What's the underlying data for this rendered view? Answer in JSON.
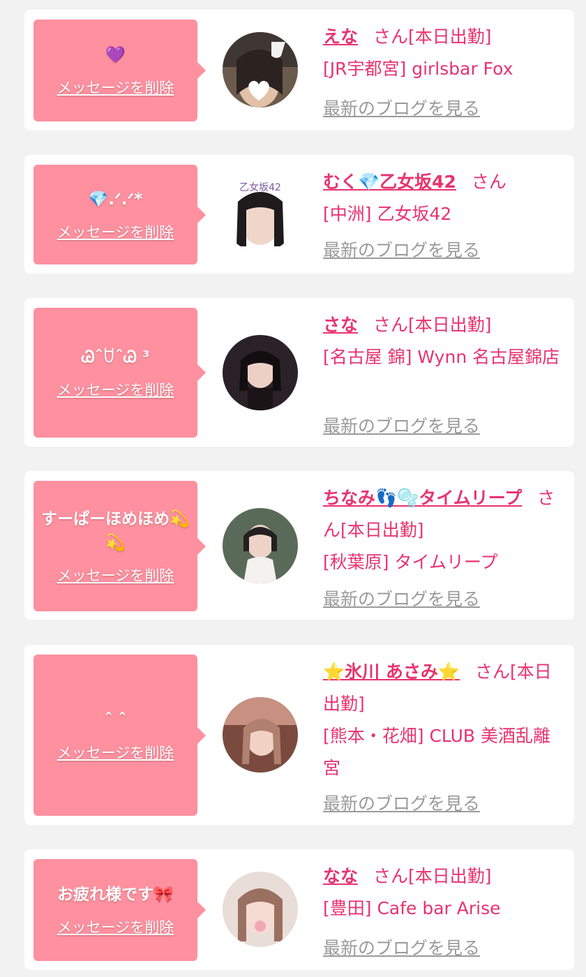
{
  "accent_color": "#e8336e",
  "bubble_color": "#ff909f",
  "cards": [
    {
      "message": "💜",
      "delete_label": "メッセージを削除",
      "name": "えな",
      "suffix": "さん[本日出勤]",
      "shop": "[JR宇都宮] girlsbar Fox",
      "blog_label": "最新のブログを見る"
    },
    {
      "message": "💎.ᐟ‪.ᐟ‪*",
      "delete_label": "メッセージを削除",
      "name": "むく💎乙女坂42",
      "suffix": "さん",
      "shop": "[中洲] 乙女坂42",
      "blog_label": "最新のブログを見る"
    },
    {
      "message": "ᏊˆꇴˆᏊ ³",
      "delete_label": "メッセージを削除",
      "name": "さな",
      "suffix": "さん[本日出勤]",
      "shop": "[名古屋 錦] Wynn 名古屋錦店",
      "blog_label": "最新のブログを見る"
    },
    {
      "message": "すーぱーほめほめ💫💫",
      "delete_label": "メッセージを削除",
      "name": "ちなみ👣🫧タイムリープ",
      "suffix": "さん[本日出勤]",
      "shop": "[秋葉原] タイムリープ",
      "blog_label": "最新のブログを見る"
    },
    {
      "message": "ˆ ˆ",
      "delete_label": "メッセージを削除",
      "name": "⭐氷川 あさみ⭐",
      "suffix": "さん[本日出勤]",
      "shop": "[熊本・花畑] CLUB 美酒乱離宮",
      "blog_label": "最新のブログを見る"
    },
    {
      "message": "お疲れ様です🎀",
      "delete_label": "メッセージを削除",
      "name": "なな",
      "suffix": "さん[本日出勤]",
      "shop": "[豊田] Cafe bar Arise",
      "blog_label": "最新のブログを見る"
    }
  ]
}
